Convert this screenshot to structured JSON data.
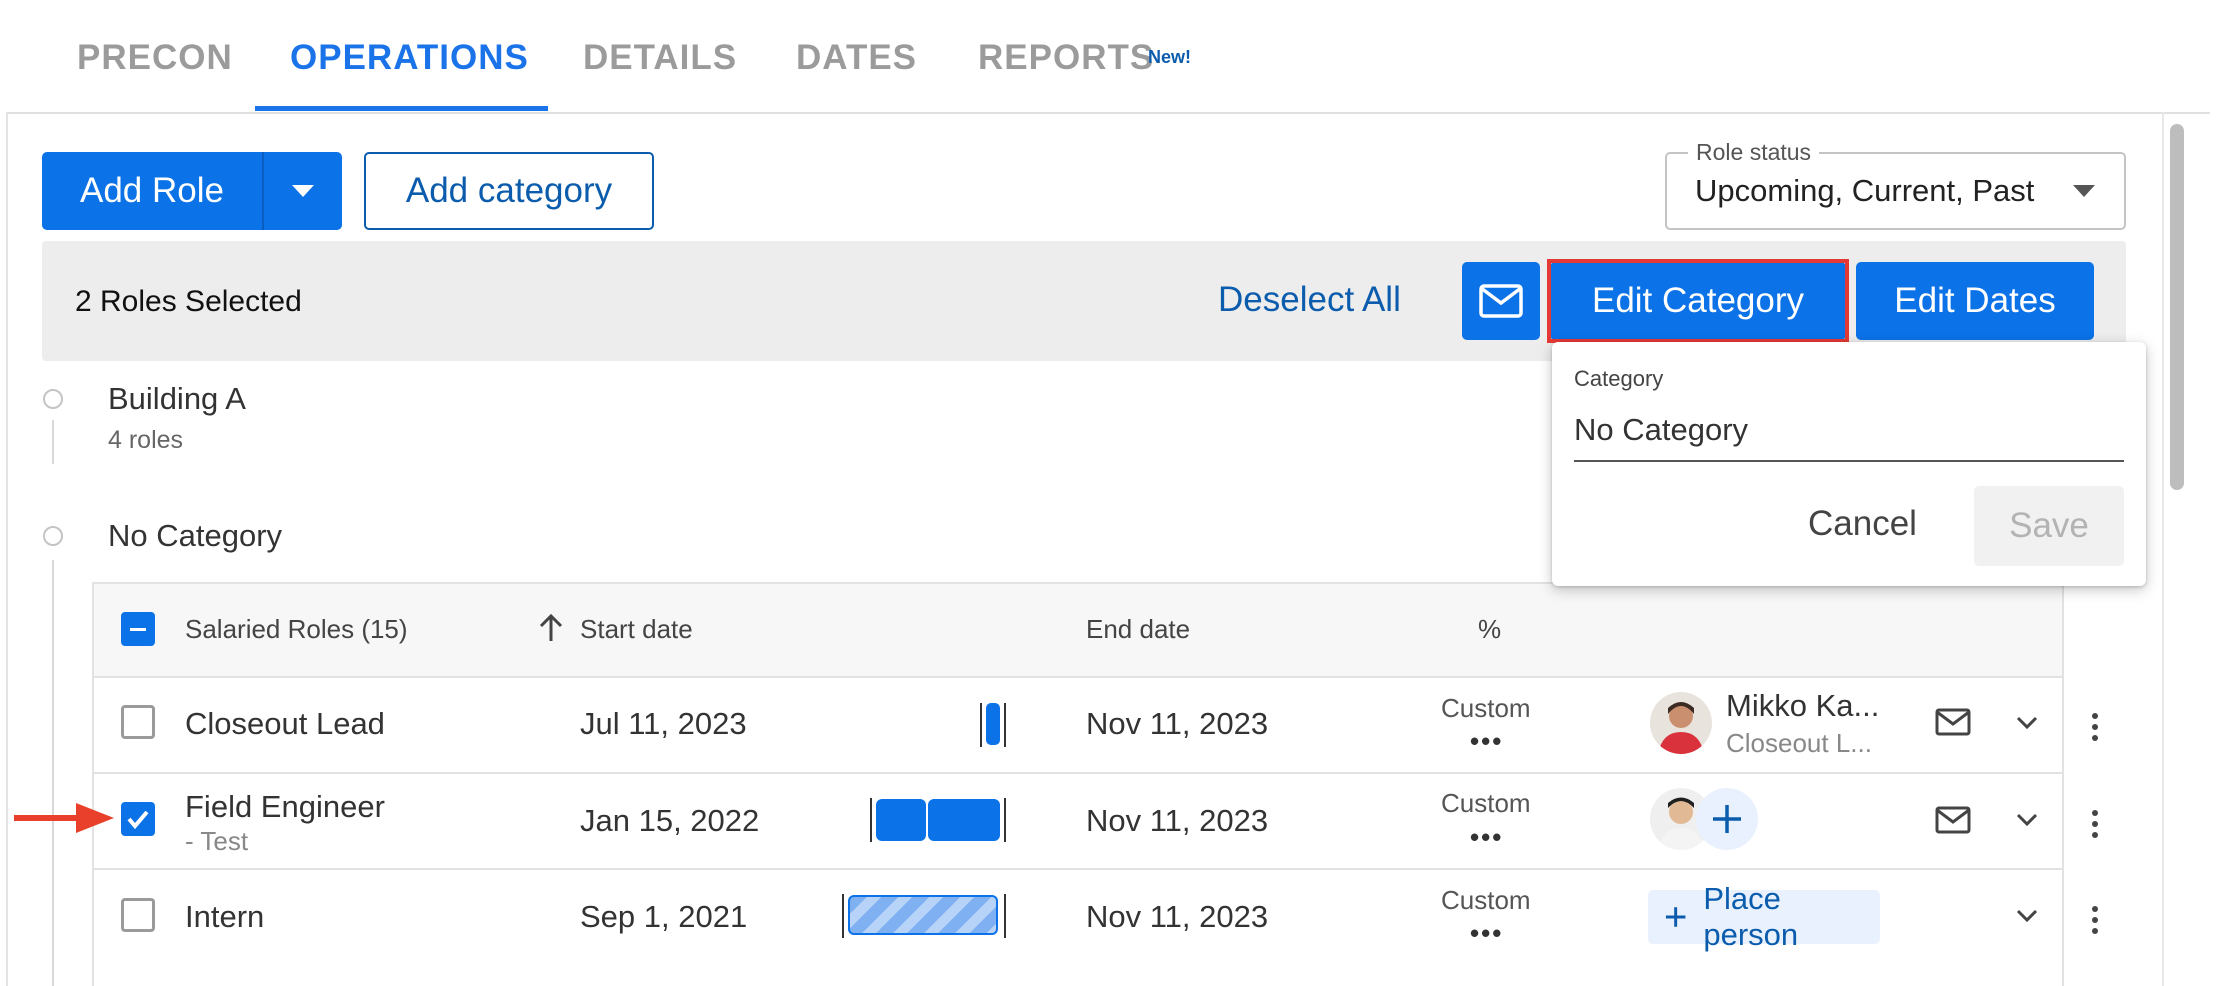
{
  "tabs": [
    {
      "label": "PRECON"
    },
    {
      "label": "OPERATIONS"
    },
    {
      "label": "DETAILS"
    },
    {
      "label": "DATES"
    },
    {
      "label": "REPORTS",
      "badge": "New!"
    }
  ],
  "toolbar": {
    "add_role_label": "Add Role",
    "add_category_label": "Add category",
    "role_status_label": "Role status",
    "role_status_value": "Upcoming, Current, Past"
  },
  "selection": {
    "count_text": "2 Roles Selected",
    "deselect_label": "Deselect All",
    "edit_category_label": "Edit Category",
    "edit_dates_label": "Edit Dates"
  },
  "popover": {
    "field_label": "Category",
    "field_value": "No Category",
    "cancel_label": "Cancel",
    "save_label": "Save"
  },
  "categories": [
    {
      "name": "Building A",
      "sub": "4 roles"
    },
    {
      "name": "No Category"
    }
  ],
  "table": {
    "headers": {
      "roles": "Salaried Roles (15)",
      "start": "Start date",
      "end": "End date",
      "percent": "%"
    },
    "rows": [
      {
        "role": "Closeout Lead",
        "sub": "",
        "start": "Jul 11, 2023",
        "end": "Nov 11, 2023",
        "percent": "Custom",
        "person_name": "Mikko Ka...",
        "person_role": "Closeout L...",
        "checked": false
      },
      {
        "role": "Field Engineer",
        "sub": "- Test",
        "start": "Jan 15, 2022",
        "end": "Nov 11, 2023",
        "percent": "Custom",
        "checked": true
      },
      {
        "role": "Intern",
        "sub": "",
        "start": "Sep 1, 2021",
        "end": "Nov 11, 2023",
        "percent": "Custom",
        "place_label": "Place person",
        "checked": false
      }
    ]
  },
  "colors": {
    "accent": "#0b72e7",
    "highlight_border": "#e53935",
    "arrow": "#e8402a"
  }
}
